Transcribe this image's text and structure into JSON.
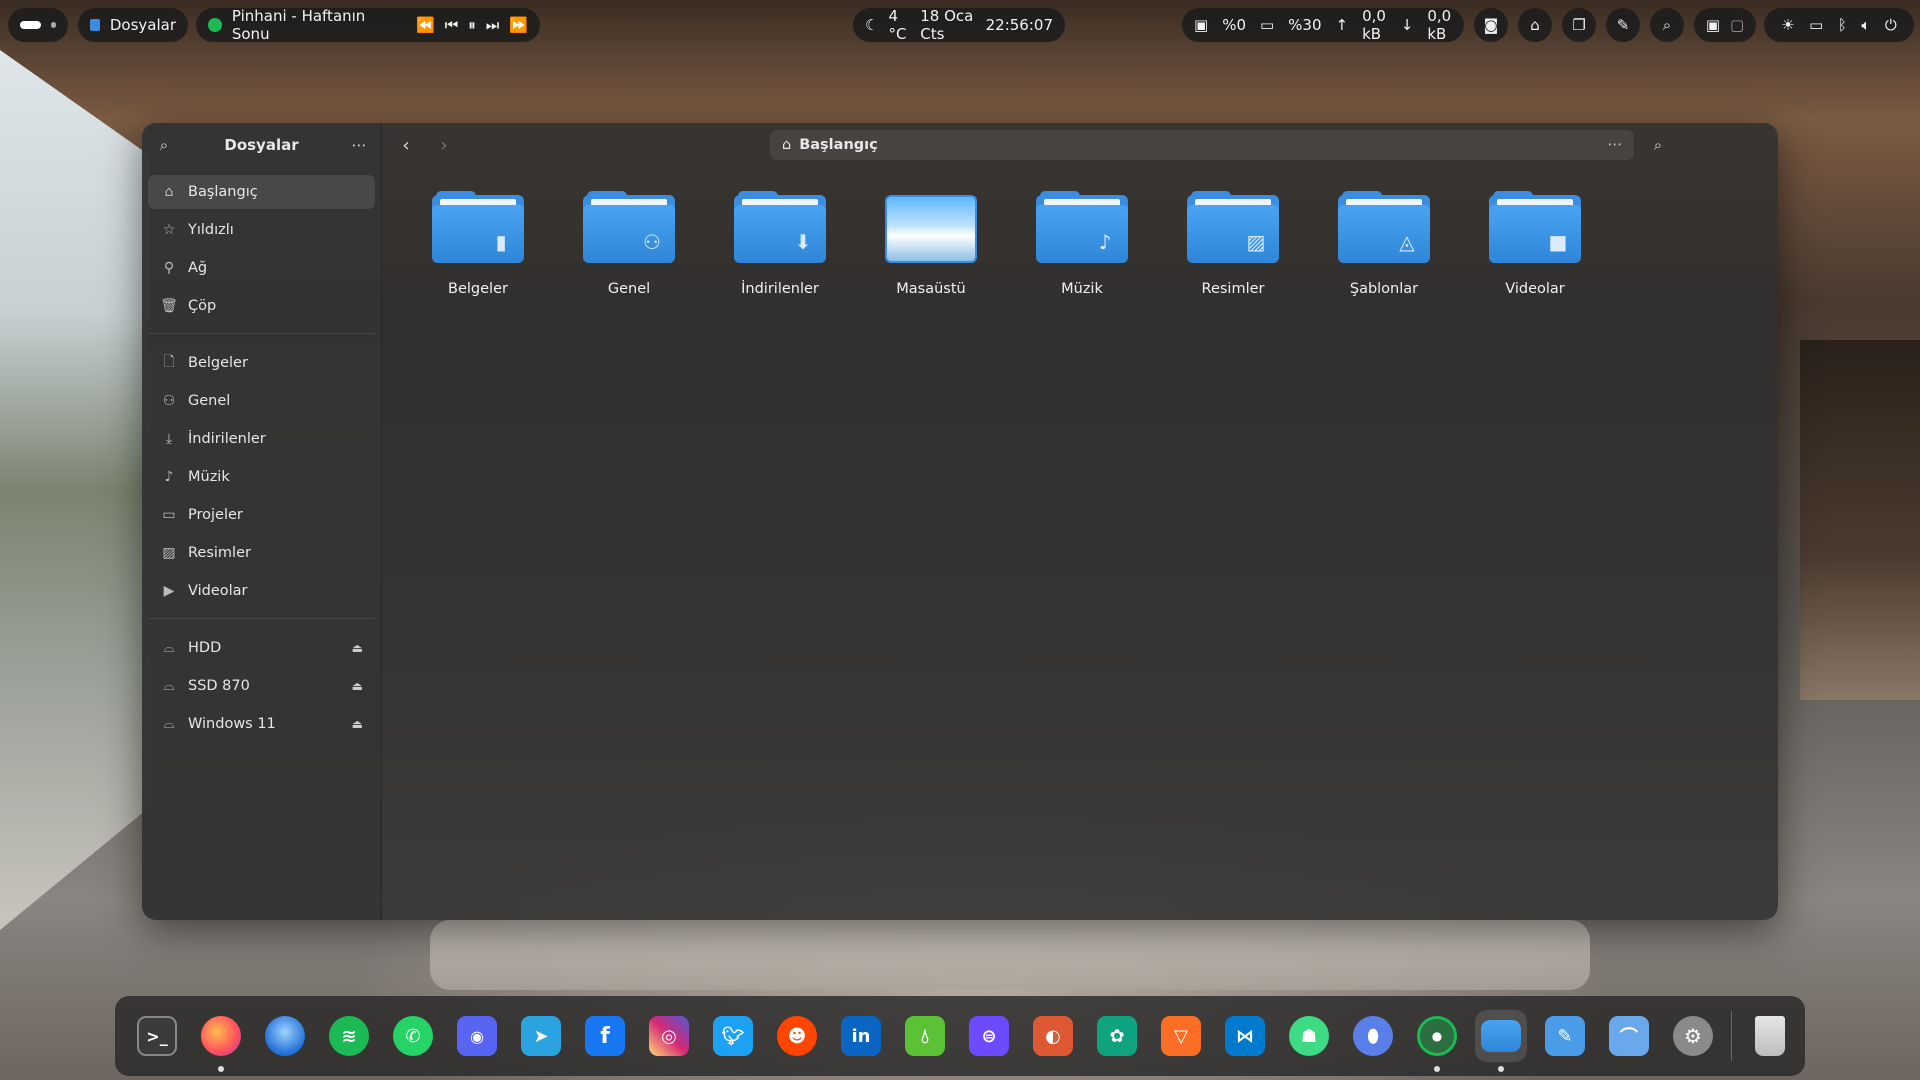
{
  "topbar": {
    "app_name": "Dosyalar",
    "media_title": "Pinhani - Haftanın Sonu",
    "weather": "4 °C",
    "date": "18 Oca Cts",
    "time": "22:56:07",
    "cpu": "%0",
    "ram": "%30",
    "upload": "0,0 kB",
    "download": "0,0 kB"
  },
  "sidebar": {
    "title": "Dosyalar",
    "places": [
      {
        "label": "Başlangıç",
        "icon": "home-icon"
      },
      {
        "label": "Yıldızlı",
        "icon": "star-icon"
      },
      {
        "label": "Ağ",
        "icon": "network-icon"
      },
      {
        "label": "Çöp",
        "icon": "trash-icon"
      }
    ],
    "bookmarks": [
      {
        "label": "Belgeler",
        "icon": "document-icon"
      },
      {
        "label": "Genel",
        "icon": "users-icon"
      },
      {
        "label": "İndirilenler",
        "icon": "download-icon"
      },
      {
        "label": "Müzik",
        "icon": "music-icon"
      },
      {
        "label": "Projeler",
        "icon": "folder-icon"
      },
      {
        "label": "Resimler",
        "icon": "image-icon"
      },
      {
        "label": "Videolar",
        "icon": "video-icon"
      }
    ],
    "drives": [
      {
        "label": "HDD",
        "icon": "drive-icon"
      },
      {
        "label": "SSD 870",
        "icon": "drive-icon"
      },
      {
        "label": "Windows 11",
        "icon": "drive-icon"
      }
    ]
  },
  "pathbar": {
    "location": "Başlangıç"
  },
  "folders": [
    {
      "label": "Belgeler",
      "emblem": "document-icon"
    },
    {
      "label": "Genel",
      "emblem": "users-icon"
    },
    {
      "label": "İndirilenler",
      "emblem": "download-icon"
    },
    {
      "label": "Masaüstü",
      "emblem": "desktop-icon"
    },
    {
      "label": "Müzik",
      "emblem": "music-icon"
    },
    {
      "label": "Resimler",
      "emblem": "image-icon"
    },
    {
      "label": "Şablonlar",
      "emblem": "template-icon"
    },
    {
      "label": "Videolar",
      "emblem": "video-icon"
    }
  ],
  "dock": [
    {
      "app": "terminal-icon",
      "color": "#3b3b3b"
    },
    {
      "app": "firefox-icon",
      "color": "#ff7139"
    },
    {
      "app": "thunderbird-icon",
      "color": "#1f6fd6"
    },
    {
      "app": "spotify-icon",
      "color": "#1db954"
    },
    {
      "app": "whatsapp-icon",
      "color": "#25d366"
    },
    {
      "app": "discord-icon",
      "color": "#5865f2"
    },
    {
      "app": "telegram-icon",
      "color": "#2aa3e0"
    },
    {
      "app": "facebook-icon",
      "color": "#1877f2"
    },
    {
      "app": "instagram-icon",
      "color": "#d6249f"
    },
    {
      "app": "twitter-icon",
      "color": "#1da1f2"
    },
    {
      "app": "reddit-icon",
      "color": "#ff4500"
    },
    {
      "app": "linkedin-icon",
      "color": "#0a66c2"
    },
    {
      "app": "drop-icon",
      "color": "#5bc236"
    },
    {
      "app": "proton-pass-icon",
      "color": "#6d4aff"
    },
    {
      "app": "duckduckgo-icon",
      "color": "#de5833"
    },
    {
      "app": "chatgpt-icon",
      "color": "#10a37f"
    },
    {
      "app": "gitlab-icon",
      "color": "#fc6d26"
    },
    {
      "app": "vscode-icon",
      "color": "#007acc"
    },
    {
      "app": "android-icon",
      "color": "#3ddc84"
    },
    {
      "app": "droplet-icon",
      "color": "#5b7fe8"
    },
    {
      "app": "spotify-client-icon",
      "color": "#1db954"
    },
    {
      "app": "files-icon",
      "color": "#3a8de0"
    },
    {
      "app": "text-editor-icon",
      "color": "#4a9be8"
    },
    {
      "app": "software-icon",
      "color": "#6aa8ec"
    },
    {
      "app": "settings-icon",
      "color": "#8a8a8a"
    },
    {
      "app": "trash-icon",
      "color": "#cfcfcf"
    }
  ]
}
